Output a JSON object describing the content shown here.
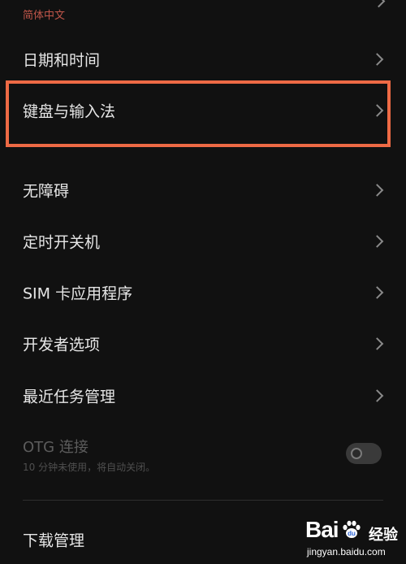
{
  "language": {
    "value": "简体中文"
  },
  "settings": {
    "items": [
      {
        "label": "日期和时间"
      },
      {
        "label": "键盘与输入法"
      },
      {
        "label": "无障碍"
      },
      {
        "label": "定时开关机"
      },
      {
        "label": "SIM 卡应用程序"
      },
      {
        "label": "开发者选项"
      },
      {
        "label": "最近任务管理"
      }
    ],
    "otg": {
      "title": "OTG 连接",
      "subtitle": "10 分钟未使用，将自动关闭。",
      "enabled": false
    },
    "download": {
      "label": "下载管理"
    }
  },
  "watermark": {
    "brand": "Bai",
    "product": "经验",
    "url": "jingyan.baidu.com"
  },
  "colors": {
    "background": "#111111",
    "highlight": "#ee6a45",
    "language_value": "#c0564a"
  },
  "icons": {
    "chevron": "chevron-right-icon",
    "watermark_logo": "baidu-paw-icon"
  }
}
